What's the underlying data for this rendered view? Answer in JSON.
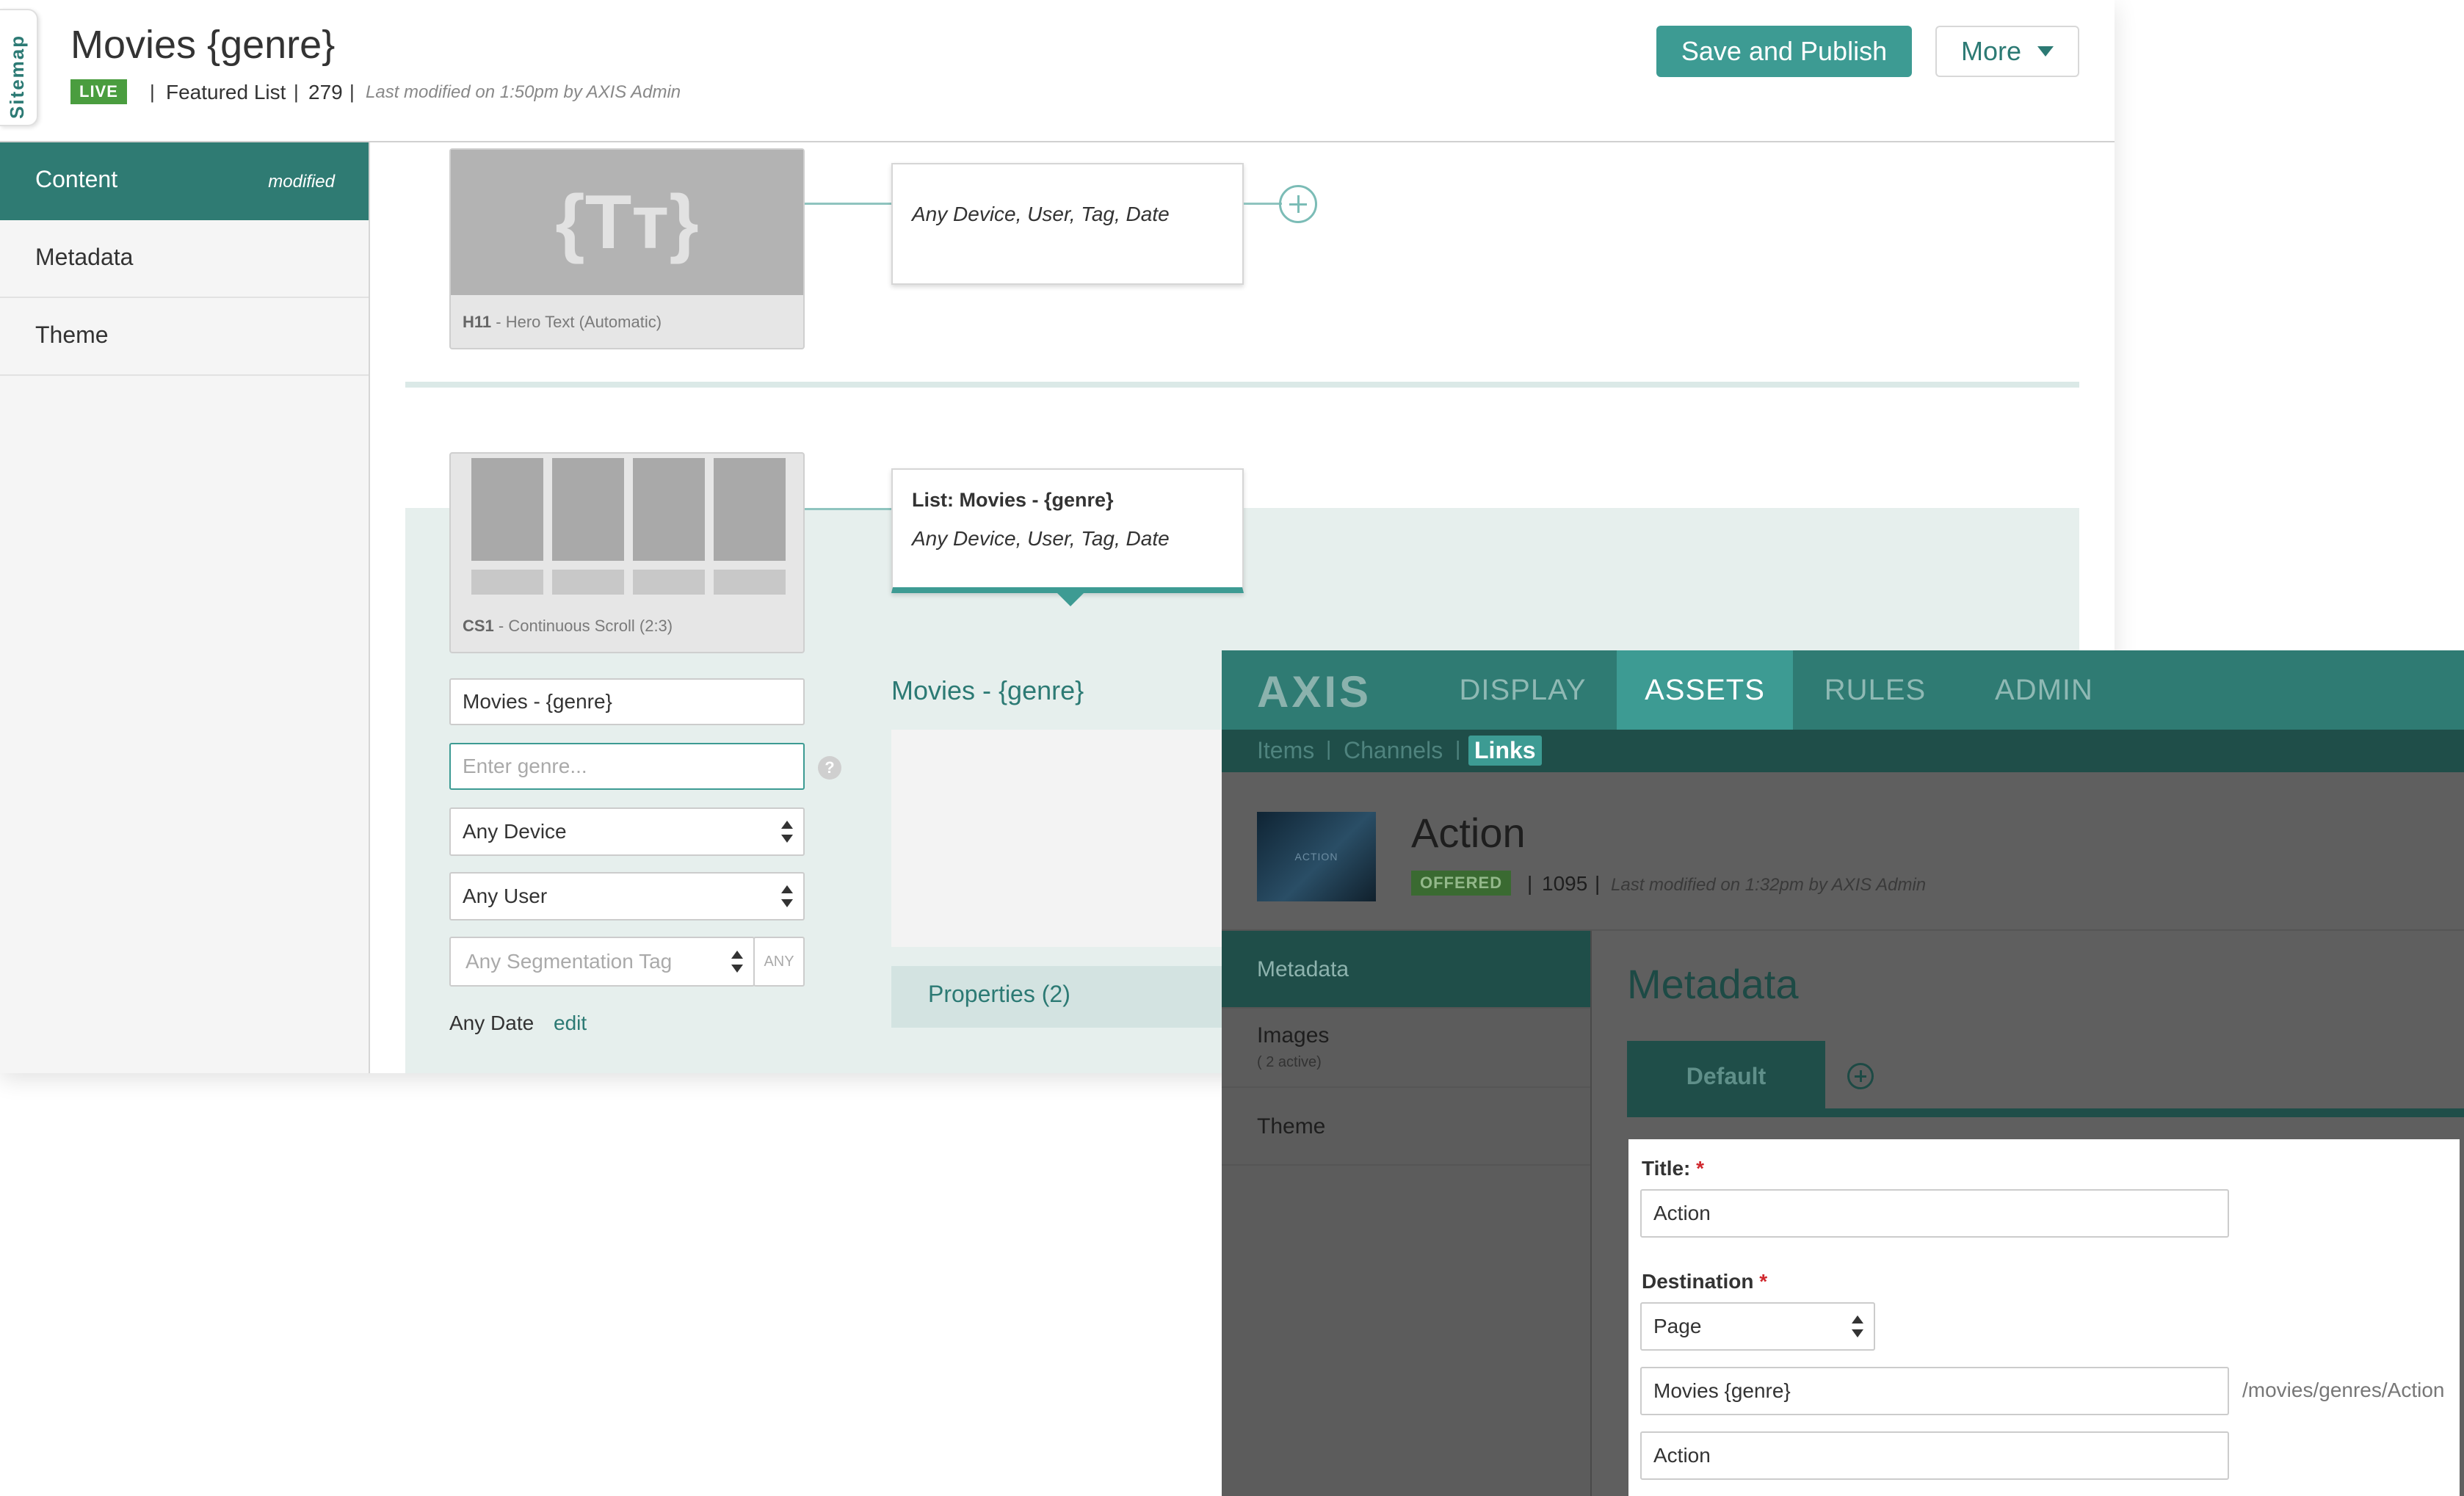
{
  "back": {
    "sitemap_tab": "Sitemap",
    "title": "Movies {genre}",
    "status": "LIVE",
    "sep": "|",
    "type": "Featured List",
    "id": "279",
    "modified": "Last modified on 1:50pm by AXIS Admin",
    "save_button": "Save and Publish",
    "more_button": "More",
    "nav": [
      {
        "label": "Content",
        "badge": "modified"
      },
      {
        "label": "Metadata"
      },
      {
        "label": "Theme"
      }
    ],
    "row1": {
      "thumb_glyph": "{Tт}",
      "thumb_code": "H11",
      "thumb_caption": " - Hero Text (Automatic)",
      "card_text": "Any Device, User, Tag, Date"
    },
    "row2": {
      "thumb_code": "CS1",
      "thumb_caption": " - Continuous Scroll (2:3)",
      "card_title": "List: Movies - {genre}",
      "card_text": "Any Device, User, Tag, Date",
      "list_name_value": "Movies - {genre}",
      "genre_placeholder": "Enter genre...",
      "help": "?",
      "device_value": "Any Device",
      "user_value": "Any User",
      "tag_placeholder": "Any Segmentation Tag",
      "tag_any": "ANY",
      "date_text": "Any Date",
      "date_edit": "edit",
      "preview_title": "Movies - {genre}",
      "properties": "Properties (2)"
    }
  },
  "front": {
    "logo": "AXIS",
    "tabs": [
      "DISPLAY",
      "ASSETS",
      "RULES",
      "ADMIN"
    ],
    "active_tab": "ASSETS",
    "subnav": [
      "Items",
      "Channels",
      "Links"
    ],
    "sep": "|",
    "asset": {
      "thumb_text": "ACTION",
      "title": "Action",
      "status": "OFFERED",
      "id": "1095",
      "modified": "Last modified on 1:32pm by AXIS Admin"
    },
    "nav": [
      {
        "label": "Metadata"
      },
      {
        "label": "Images",
        "sub": "( 2 active)"
      },
      {
        "label": "Theme"
      }
    ],
    "section_title": "Metadata",
    "tab_default": "Default",
    "form": {
      "title_label": "Title:",
      "required": "*",
      "title_value": "Action",
      "destination_label": "Destination",
      "destination_value": "Page",
      "page_value": "Movies {genre}",
      "path": "/movies/genres/Action",
      "param_value": "Action"
    }
  }
}
